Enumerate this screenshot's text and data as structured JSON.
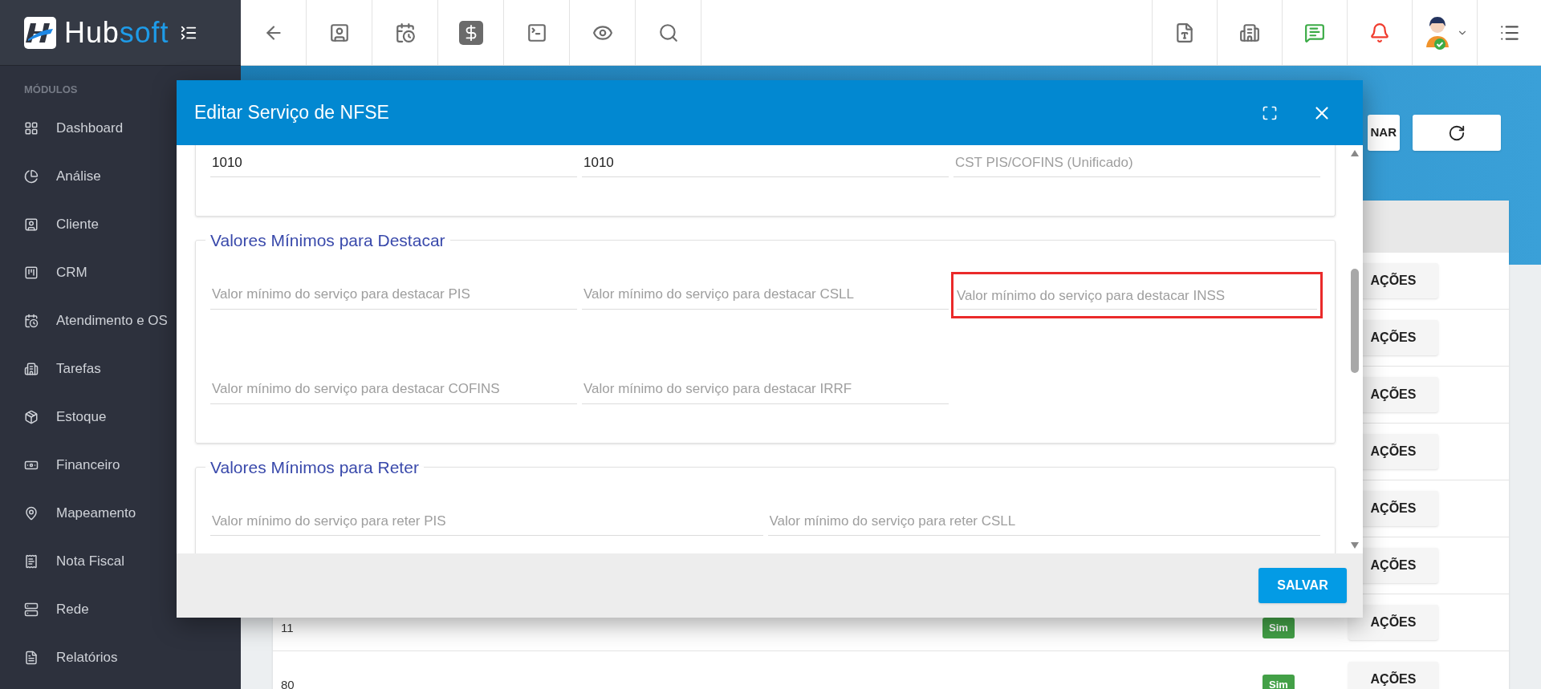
{
  "brand": {
    "part_a": "Hub",
    "part_b": "soft"
  },
  "sidebar": {
    "heading": "MÓDULOS",
    "items": [
      {
        "label": "Dashboard"
      },
      {
        "label": "Análise"
      },
      {
        "label": "Cliente"
      },
      {
        "label": "CRM"
      },
      {
        "label": "Atendimento e OS"
      },
      {
        "label": "Tarefas"
      },
      {
        "label": "Estoque"
      },
      {
        "label": "Financeiro"
      },
      {
        "label": "Mapeamento"
      },
      {
        "label": "Nota Fiscal"
      },
      {
        "label": "Rede"
      },
      {
        "label": "Relatórios"
      }
    ]
  },
  "page": {
    "header_buttons": [
      {
        "label": "NAR"
      }
    ],
    "rows": [
      {
        "action": "AÇÕES"
      },
      {
        "action": "AÇÕES"
      },
      {
        "action": "AÇÕES"
      },
      {
        "action": "AÇÕES"
      },
      {
        "action": "AÇÕES"
      },
      {
        "action": "AÇÕES"
      },
      {
        "id": "11",
        "flag": "Sim",
        "action": "AÇÕES"
      },
      {
        "id": "80",
        "flag": "Sim",
        "action": "AÇÕES"
      }
    ]
  },
  "modal": {
    "title": "Editar Serviço de NFSE",
    "sections": [
      {
        "fields": [
          {
            "value": "1010",
            "highlighted": false
          },
          {
            "value": "1010",
            "highlighted": false
          },
          {
            "placeholder": "CST PIS/COFINS (Unificado)",
            "highlighted": false
          }
        ]
      },
      {
        "legend": "Valores Mínimos para Destacar",
        "fields": [
          {
            "placeholder": "Valor mínimo do serviço para destacar PIS",
            "highlighted": false
          },
          {
            "placeholder": "Valor mínimo do serviço para destacar CSLL",
            "highlighted": false
          },
          {
            "placeholder": "Valor mínimo do serviço para destacar INSS",
            "highlighted": true
          },
          {
            "placeholder": "Valor mínimo do serviço para destacar COFINS",
            "highlighted": false
          },
          {
            "placeholder": "Valor mínimo do serviço para destacar IRRF",
            "highlighted": false
          }
        ]
      },
      {
        "legend": "Valores Mínimos para Reter",
        "fields": [
          {
            "placeholder": "Valor mínimo do serviço para reter PIS",
            "highlighted": false
          },
          {
            "placeholder": "Valor mínimo do serviço para reter CSLL",
            "highlighted": false
          }
        ]
      }
    ],
    "save": "SALVAR"
  }
}
